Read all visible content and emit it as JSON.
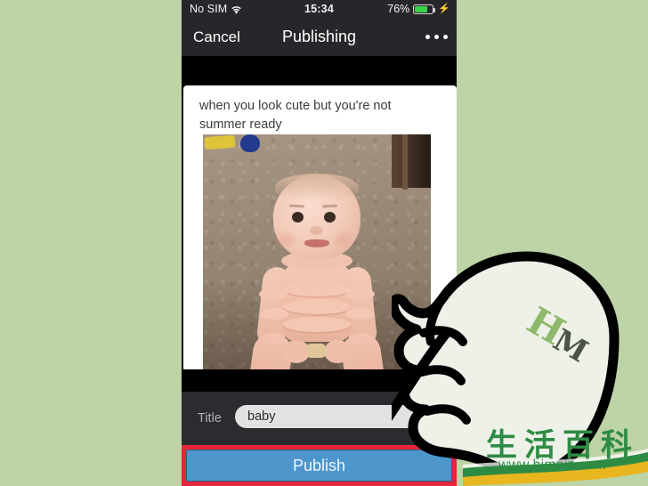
{
  "background": {
    "color": "#bcd4a6"
  },
  "phone": {
    "status_bar": {
      "carrier": "No SIM",
      "wifi_icon": "wifi-icon",
      "time": "15:34",
      "battery_percent": "76%",
      "battery_icon": "battery-icon",
      "charging_icon": "lightning-bolt-icon",
      "battery_level": 76,
      "battery_fill_color": "#3ad14b",
      "bar_color": "#27272b"
    },
    "nav_bar": {
      "cancel_label": "Cancel",
      "title": "Publishing",
      "more_icon": "ellipsis-icon",
      "bar_color": "#27272b"
    },
    "post_preview": {
      "caption": "when you look cute but you're not summer ready",
      "photo_alt": "baby-photo",
      "card_background": "#ffffff"
    },
    "form": {
      "title_label": "Title",
      "title_value": "baby",
      "title_placeholder": "Title",
      "background": "#2c2c30"
    },
    "publish": {
      "label": "Publish",
      "button_color": "#4d96cc",
      "highlight_color": "#e5253b"
    }
  },
  "overlay": {
    "hand_cursor_icon": "pointing-hand-cursor-icon",
    "hand_mark_letters": "HM",
    "hand_mark_h_color": "#8fb96a",
    "hand_mark_m_color": "#4c5348"
  },
  "watermark": {
    "chinese_text": "生活百科",
    "url": "www.bimeiz.com",
    "color": "#2e8b43"
  }
}
